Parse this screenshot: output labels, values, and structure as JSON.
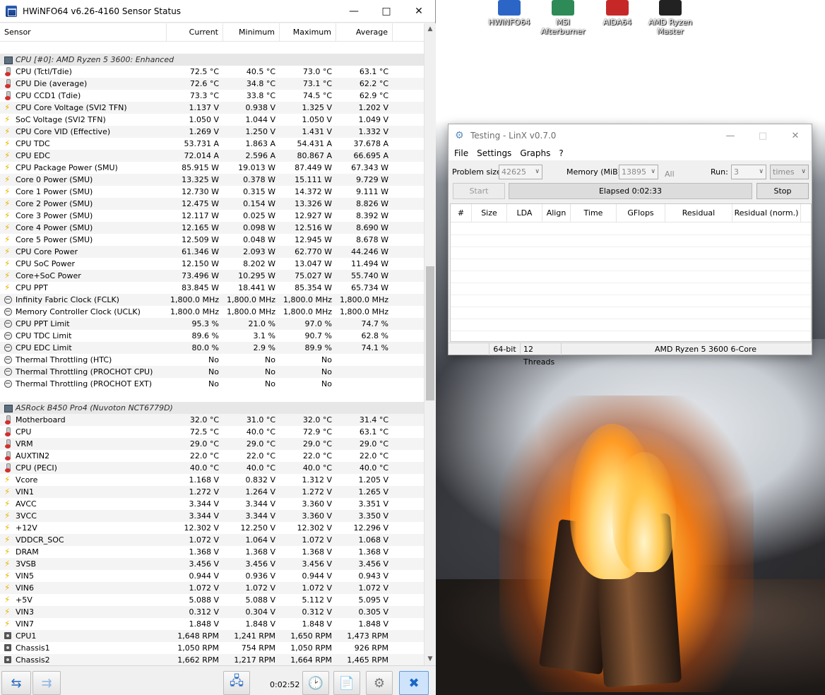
{
  "hwinfo": {
    "title": "HWiNFO64 v6.26-4160 Sensor Status",
    "columns": [
      "Sensor",
      "Current",
      "Minimum",
      "Maximum",
      "Average"
    ],
    "elapsed": "0:02:52",
    "groups": [
      {
        "name": "CPU [#0]: AMD Ryzen 5 3600: Enhanced",
        "rows": [
          {
            "icon": "temp",
            "name": "CPU (Tctl/Tdie)",
            "cur": "72.5 °C",
            "min": "40.5 °C",
            "max": "73.0 °C",
            "avg": "63.1 °C"
          },
          {
            "icon": "temp",
            "name": "CPU Die (average)",
            "cur": "72.6 °C",
            "min": "34.8 °C",
            "max": "73.1 °C",
            "avg": "62.2 °C"
          },
          {
            "icon": "temp",
            "name": "CPU CCD1 (Tdie)",
            "cur": "73.3 °C",
            "min": "33.8 °C",
            "max": "74.5 °C",
            "avg": "62.9 °C"
          },
          {
            "icon": "volt",
            "name": "CPU Core Voltage (SVI2 TFN)",
            "cur": "1.137 V",
            "min": "0.938 V",
            "max": "1.325 V",
            "avg": "1.202 V"
          },
          {
            "icon": "volt",
            "name": "SoC Voltage (SVI2 TFN)",
            "cur": "1.050 V",
            "min": "1.044 V",
            "max": "1.050 V",
            "avg": "1.049 V"
          },
          {
            "icon": "volt",
            "name": "CPU Core VID (Effective)",
            "cur": "1.269 V",
            "min": "1.250 V",
            "max": "1.431 V",
            "avg": "1.332 V"
          },
          {
            "icon": "volt",
            "name": "CPU TDC",
            "cur": "53.731 A",
            "min": "1.863 A",
            "max": "54.431 A",
            "avg": "37.678 A"
          },
          {
            "icon": "volt",
            "name": "CPU EDC",
            "cur": "72.014 A",
            "min": "2.596 A",
            "max": "80.867 A",
            "avg": "66.695 A"
          },
          {
            "icon": "volt",
            "name": "CPU Package Power (SMU)",
            "cur": "85.915 W",
            "min": "19.013 W",
            "max": "87.449 W",
            "avg": "67.343 W"
          },
          {
            "icon": "volt",
            "name": "Core 0 Power (SMU)",
            "cur": "13.325 W",
            "min": "0.378 W",
            "max": "15.111 W",
            "avg": "9.729 W"
          },
          {
            "icon": "volt",
            "name": "Core 1 Power (SMU)",
            "cur": "12.730 W",
            "min": "0.315 W",
            "max": "14.372 W",
            "avg": "9.111 W"
          },
          {
            "icon": "volt",
            "name": "Core 2 Power (SMU)",
            "cur": "12.475 W",
            "min": "0.154 W",
            "max": "13.326 W",
            "avg": "8.826 W"
          },
          {
            "icon": "volt",
            "name": "Core 3 Power (SMU)",
            "cur": "12.117 W",
            "min": "0.025 W",
            "max": "12.927 W",
            "avg": "8.392 W"
          },
          {
            "icon": "volt",
            "name": "Core 4 Power (SMU)",
            "cur": "12.165 W",
            "min": "0.098 W",
            "max": "12.516 W",
            "avg": "8.690 W"
          },
          {
            "icon": "volt",
            "name": "Core 5 Power (SMU)",
            "cur": "12.509 W",
            "min": "0.048 W",
            "max": "12.945 W",
            "avg": "8.678 W"
          },
          {
            "icon": "volt",
            "name": "CPU Core Power",
            "cur": "61.346 W",
            "min": "2.093 W",
            "max": "62.770 W",
            "avg": "44.246 W"
          },
          {
            "icon": "volt",
            "name": "CPU SoC Power",
            "cur": "12.150 W",
            "min": "8.202 W",
            "max": "13.047 W",
            "avg": "11.494 W"
          },
          {
            "icon": "volt",
            "name": "Core+SoC Power",
            "cur": "73.496 W",
            "min": "10.295 W",
            "max": "75.027 W",
            "avg": "55.740 W"
          },
          {
            "icon": "volt",
            "name": "CPU PPT",
            "cur": "83.845 W",
            "min": "18.441 W",
            "max": "85.354 W",
            "avg": "65.734 W"
          },
          {
            "icon": "clock",
            "name": "Infinity Fabric Clock (FCLK)",
            "cur": "1,800.0 MHz",
            "min": "1,800.0 MHz",
            "max": "1,800.0 MHz",
            "avg": "1,800.0 MHz"
          },
          {
            "icon": "clock",
            "name": "Memory Controller Clock (UCLK)",
            "cur": "1,800.0 MHz",
            "min": "1,800.0 MHz",
            "max": "1,800.0 MHz",
            "avg": "1,800.0 MHz"
          },
          {
            "icon": "clock",
            "name": "CPU PPT Limit",
            "cur": "95.3 %",
            "min": "21.0 %",
            "max": "97.0 %",
            "avg": "74.7 %"
          },
          {
            "icon": "clock",
            "name": "CPU TDC Limit",
            "cur": "89.6 %",
            "min": "3.1 %",
            "max": "90.7 %",
            "avg": "62.8 %"
          },
          {
            "icon": "clock",
            "name": "CPU EDC Limit",
            "cur": "80.0 %",
            "min": "2.9 %",
            "max": "89.9 %",
            "avg": "74.1 %"
          },
          {
            "icon": "clock",
            "name": "Thermal Throttling (HTC)",
            "cur": "No",
            "min": "No",
            "max": "No",
            "avg": ""
          },
          {
            "icon": "clock",
            "name": "Thermal Throttling (PROCHOT CPU)",
            "cur": "No",
            "min": "No",
            "max": "No",
            "avg": ""
          },
          {
            "icon": "clock",
            "name": "Thermal Throttling (PROCHOT EXT)",
            "cur": "No",
            "min": "No",
            "max": "No",
            "avg": ""
          }
        ]
      },
      {
        "name": "ASRock B450 Pro4 (Nuvoton NCT6779D)",
        "rows": [
          {
            "icon": "temp",
            "name": "Motherboard",
            "cur": "32.0 °C",
            "min": "31.0 °C",
            "max": "32.0 °C",
            "avg": "31.4 °C"
          },
          {
            "icon": "temp",
            "name": "CPU",
            "cur": "72.5 °C",
            "min": "40.0 °C",
            "max": "72.9 °C",
            "avg": "63.1 °C"
          },
          {
            "icon": "temp",
            "name": "VRM",
            "cur": "29.0 °C",
            "min": "29.0 °C",
            "max": "29.0 °C",
            "avg": "29.0 °C"
          },
          {
            "icon": "temp",
            "name": "AUXTIN2",
            "cur": "22.0 °C",
            "min": "22.0 °C",
            "max": "22.0 °C",
            "avg": "22.0 °C"
          },
          {
            "icon": "temp",
            "name": "CPU (PECI)",
            "cur": "40.0 °C",
            "min": "40.0 °C",
            "max": "40.0 °C",
            "avg": "40.0 °C"
          },
          {
            "icon": "volt",
            "name": "Vcore",
            "cur": "1.168 V",
            "min": "0.832 V",
            "max": "1.312 V",
            "avg": "1.205 V"
          },
          {
            "icon": "volt",
            "name": "VIN1",
            "cur": "1.272 V",
            "min": "1.264 V",
            "max": "1.272 V",
            "avg": "1.265 V"
          },
          {
            "icon": "volt",
            "name": "AVCC",
            "cur": "3.344 V",
            "min": "3.344 V",
            "max": "3.360 V",
            "avg": "3.351 V"
          },
          {
            "icon": "volt",
            "name": "3VCC",
            "cur": "3.344 V",
            "min": "3.344 V",
            "max": "3.360 V",
            "avg": "3.350 V"
          },
          {
            "icon": "volt",
            "name": "+12V",
            "cur": "12.302 V",
            "min": "12.250 V",
            "max": "12.302 V",
            "avg": "12.296 V"
          },
          {
            "icon": "volt",
            "name": "VDDCR_SOC",
            "cur": "1.072 V",
            "min": "1.064 V",
            "max": "1.072 V",
            "avg": "1.068 V"
          },
          {
            "icon": "volt",
            "name": "DRAM",
            "cur": "1.368 V",
            "min": "1.368 V",
            "max": "1.368 V",
            "avg": "1.368 V"
          },
          {
            "icon": "volt",
            "name": "3VSB",
            "cur": "3.456 V",
            "min": "3.456 V",
            "max": "3.456 V",
            "avg": "3.456 V"
          },
          {
            "icon": "volt",
            "name": "VIN5",
            "cur": "0.944 V",
            "min": "0.936 V",
            "max": "0.944 V",
            "avg": "0.943 V"
          },
          {
            "icon": "volt",
            "name": "VIN6",
            "cur": "1.072 V",
            "min": "1.072 V",
            "max": "1.072 V",
            "avg": "1.072 V"
          },
          {
            "icon": "volt",
            "name": "+5V",
            "cur": "5.088 V",
            "min": "5.088 V",
            "max": "5.112 V",
            "avg": "5.095 V"
          },
          {
            "icon": "volt",
            "name": "VIN3",
            "cur": "0.312 V",
            "min": "0.304 V",
            "max": "0.312 V",
            "avg": "0.305 V"
          },
          {
            "icon": "volt",
            "name": "VIN7",
            "cur": "1.848 V",
            "min": "1.848 V",
            "max": "1.848 V",
            "avg": "1.848 V"
          },
          {
            "icon": "fan",
            "name": "CPU1",
            "cur": "1,648 RPM",
            "min": "1,241 RPM",
            "max": "1,650 RPM",
            "avg": "1,473 RPM"
          },
          {
            "icon": "fan",
            "name": "Chassis1",
            "cur": "1,050 RPM",
            "min": "754 RPM",
            "max": "1,050 RPM",
            "avg": "926 RPM"
          },
          {
            "icon": "fan",
            "name": "Chassis2",
            "cur": "1,662 RPM",
            "min": "1,217 RPM",
            "max": "1,664 RPM",
            "avg": "1,465 RPM"
          }
        ]
      }
    ]
  },
  "desktop_icons": [
    {
      "label": "HWiNFO64",
      "color": "#2b66c6"
    },
    {
      "label": "MSI Afterburner",
      "color": "#2e8b57"
    },
    {
      "label": "AIDA64",
      "color": "#c62828"
    },
    {
      "label": "AMD Ryzen Master",
      "color": "#222222"
    }
  ],
  "linx": {
    "title": "Testing - LinX v0.7.0",
    "menu": [
      "File",
      "Settings",
      "Graphs",
      "?"
    ],
    "problem_size_label": "Problem size:",
    "problem_size": "42625",
    "memory_label": "Memory (MiB):",
    "memory": "13895",
    "all_label": "All",
    "run_label": "Run:",
    "run": "3",
    "times": "times",
    "start": "Start",
    "elapsed": "Elapsed 0:02:33",
    "stop": "Stop",
    "columns": [
      "#",
      "Size",
      "LDA",
      "Align",
      "Time",
      "GFlops",
      "Residual",
      "Residual (norm.)"
    ],
    "status": [
      "",
      "64-bit",
      "12 Threads",
      "AMD Ryzen 5 3600 6-Core"
    ]
  }
}
